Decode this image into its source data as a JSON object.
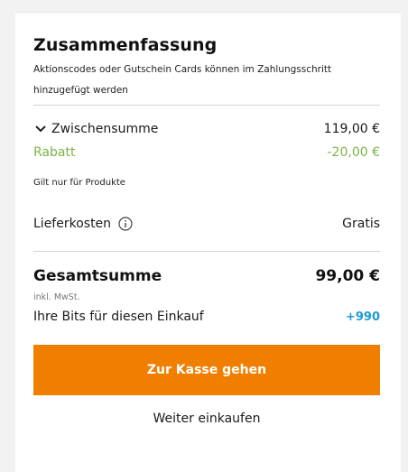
{
  "summary": {
    "title": "Zusammenfassung",
    "subtitle": "Aktionscodes oder Gutschein Cards können im Zahlungsschritt hinzugefügt werden"
  },
  "subtotal": {
    "label": "Zwischensumme",
    "value": "119,00 €",
    "icon": "chevron-down-icon"
  },
  "discount": {
    "label": "Rabatt",
    "value": "-20,00 €",
    "note": "Gilt nur für Produkte",
    "color": "#7cb342"
  },
  "shipping": {
    "label": "Lieferkosten",
    "value": "Gratis",
    "icon": "info-icon"
  },
  "total": {
    "label": "Gesamtsumme",
    "value": "99,00 €",
    "tax_note": "inkl. MwSt."
  },
  "bits": {
    "label": "Ihre Bits für diesen Einkauf",
    "value": "+990",
    "color": "#1e9ad6"
  },
  "actions": {
    "checkout_label": "Zur Kasse gehen",
    "checkout_color": "#f07f00",
    "continue_label": "Weiter einkaufen"
  }
}
